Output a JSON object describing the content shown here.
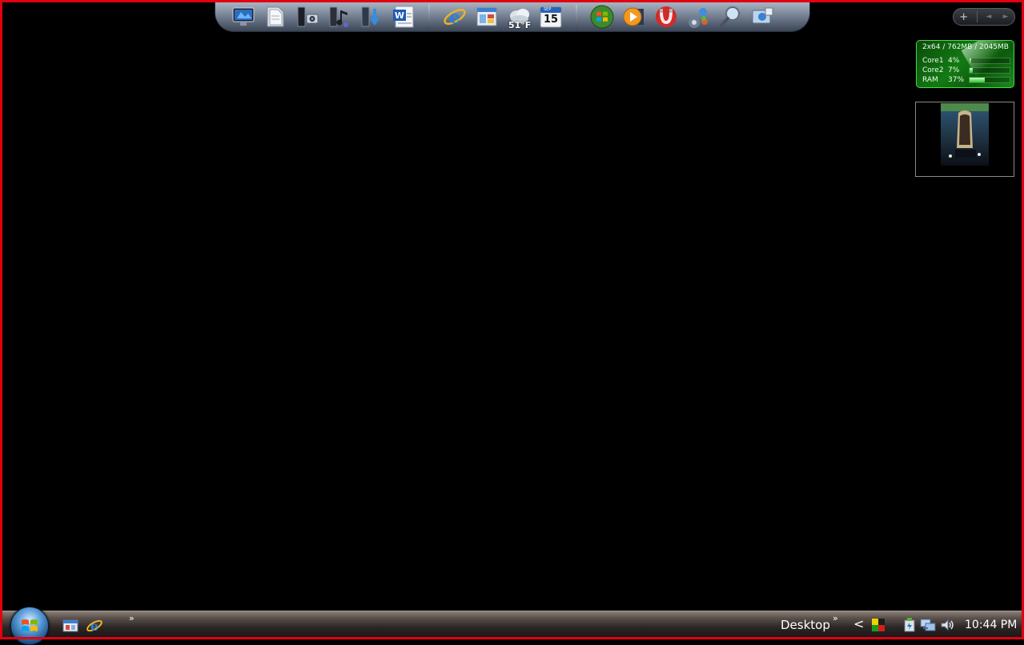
{
  "dock": {
    "icons": [
      {
        "name": "media-center-icon"
      },
      {
        "name": "documents-icon"
      },
      {
        "name": "pc-camera-icon"
      },
      {
        "name": "music-icon"
      },
      {
        "name": "downloads-icon"
      },
      {
        "name": "word-icon"
      },
      {
        "name": "internet-explorer-icon"
      },
      {
        "name": "windows-explorer-icon"
      },
      {
        "name": "weather-icon",
        "temp": "51°F"
      },
      {
        "name": "calendar-icon",
        "month": "SEP",
        "day": "15"
      },
      {
        "name": "windows-logo-icon"
      },
      {
        "name": "media-player-icon"
      },
      {
        "name": "magnet-icon"
      },
      {
        "name": "control-panel-icon"
      },
      {
        "name": "search-icon"
      },
      {
        "name": "network-icon"
      }
    ]
  },
  "sidebar": {
    "add_label": "+",
    "prev_label": "◄",
    "next_label": "►"
  },
  "cpu_meter": {
    "header": "2x64 / 762MB / 2045MB",
    "rows": [
      {
        "label": "Core1",
        "value": "4%",
        "fraction": 0.04
      },
      {
        "label": "Core2",
        "value": "7%",
        "fraction": 0.07
      },
      {
        "label": "RAM",
        "value": "37%",
        "fraction": 0.37
      }
    ]
  },
  "taskbar": {
    "quicklaunch_more": "»",
    "desktop_toolbar_label": "Desktop",
    "desktop_more": "»",
    "tray_expand": "<",
    "clock": "10:44 PM"
  }
}
